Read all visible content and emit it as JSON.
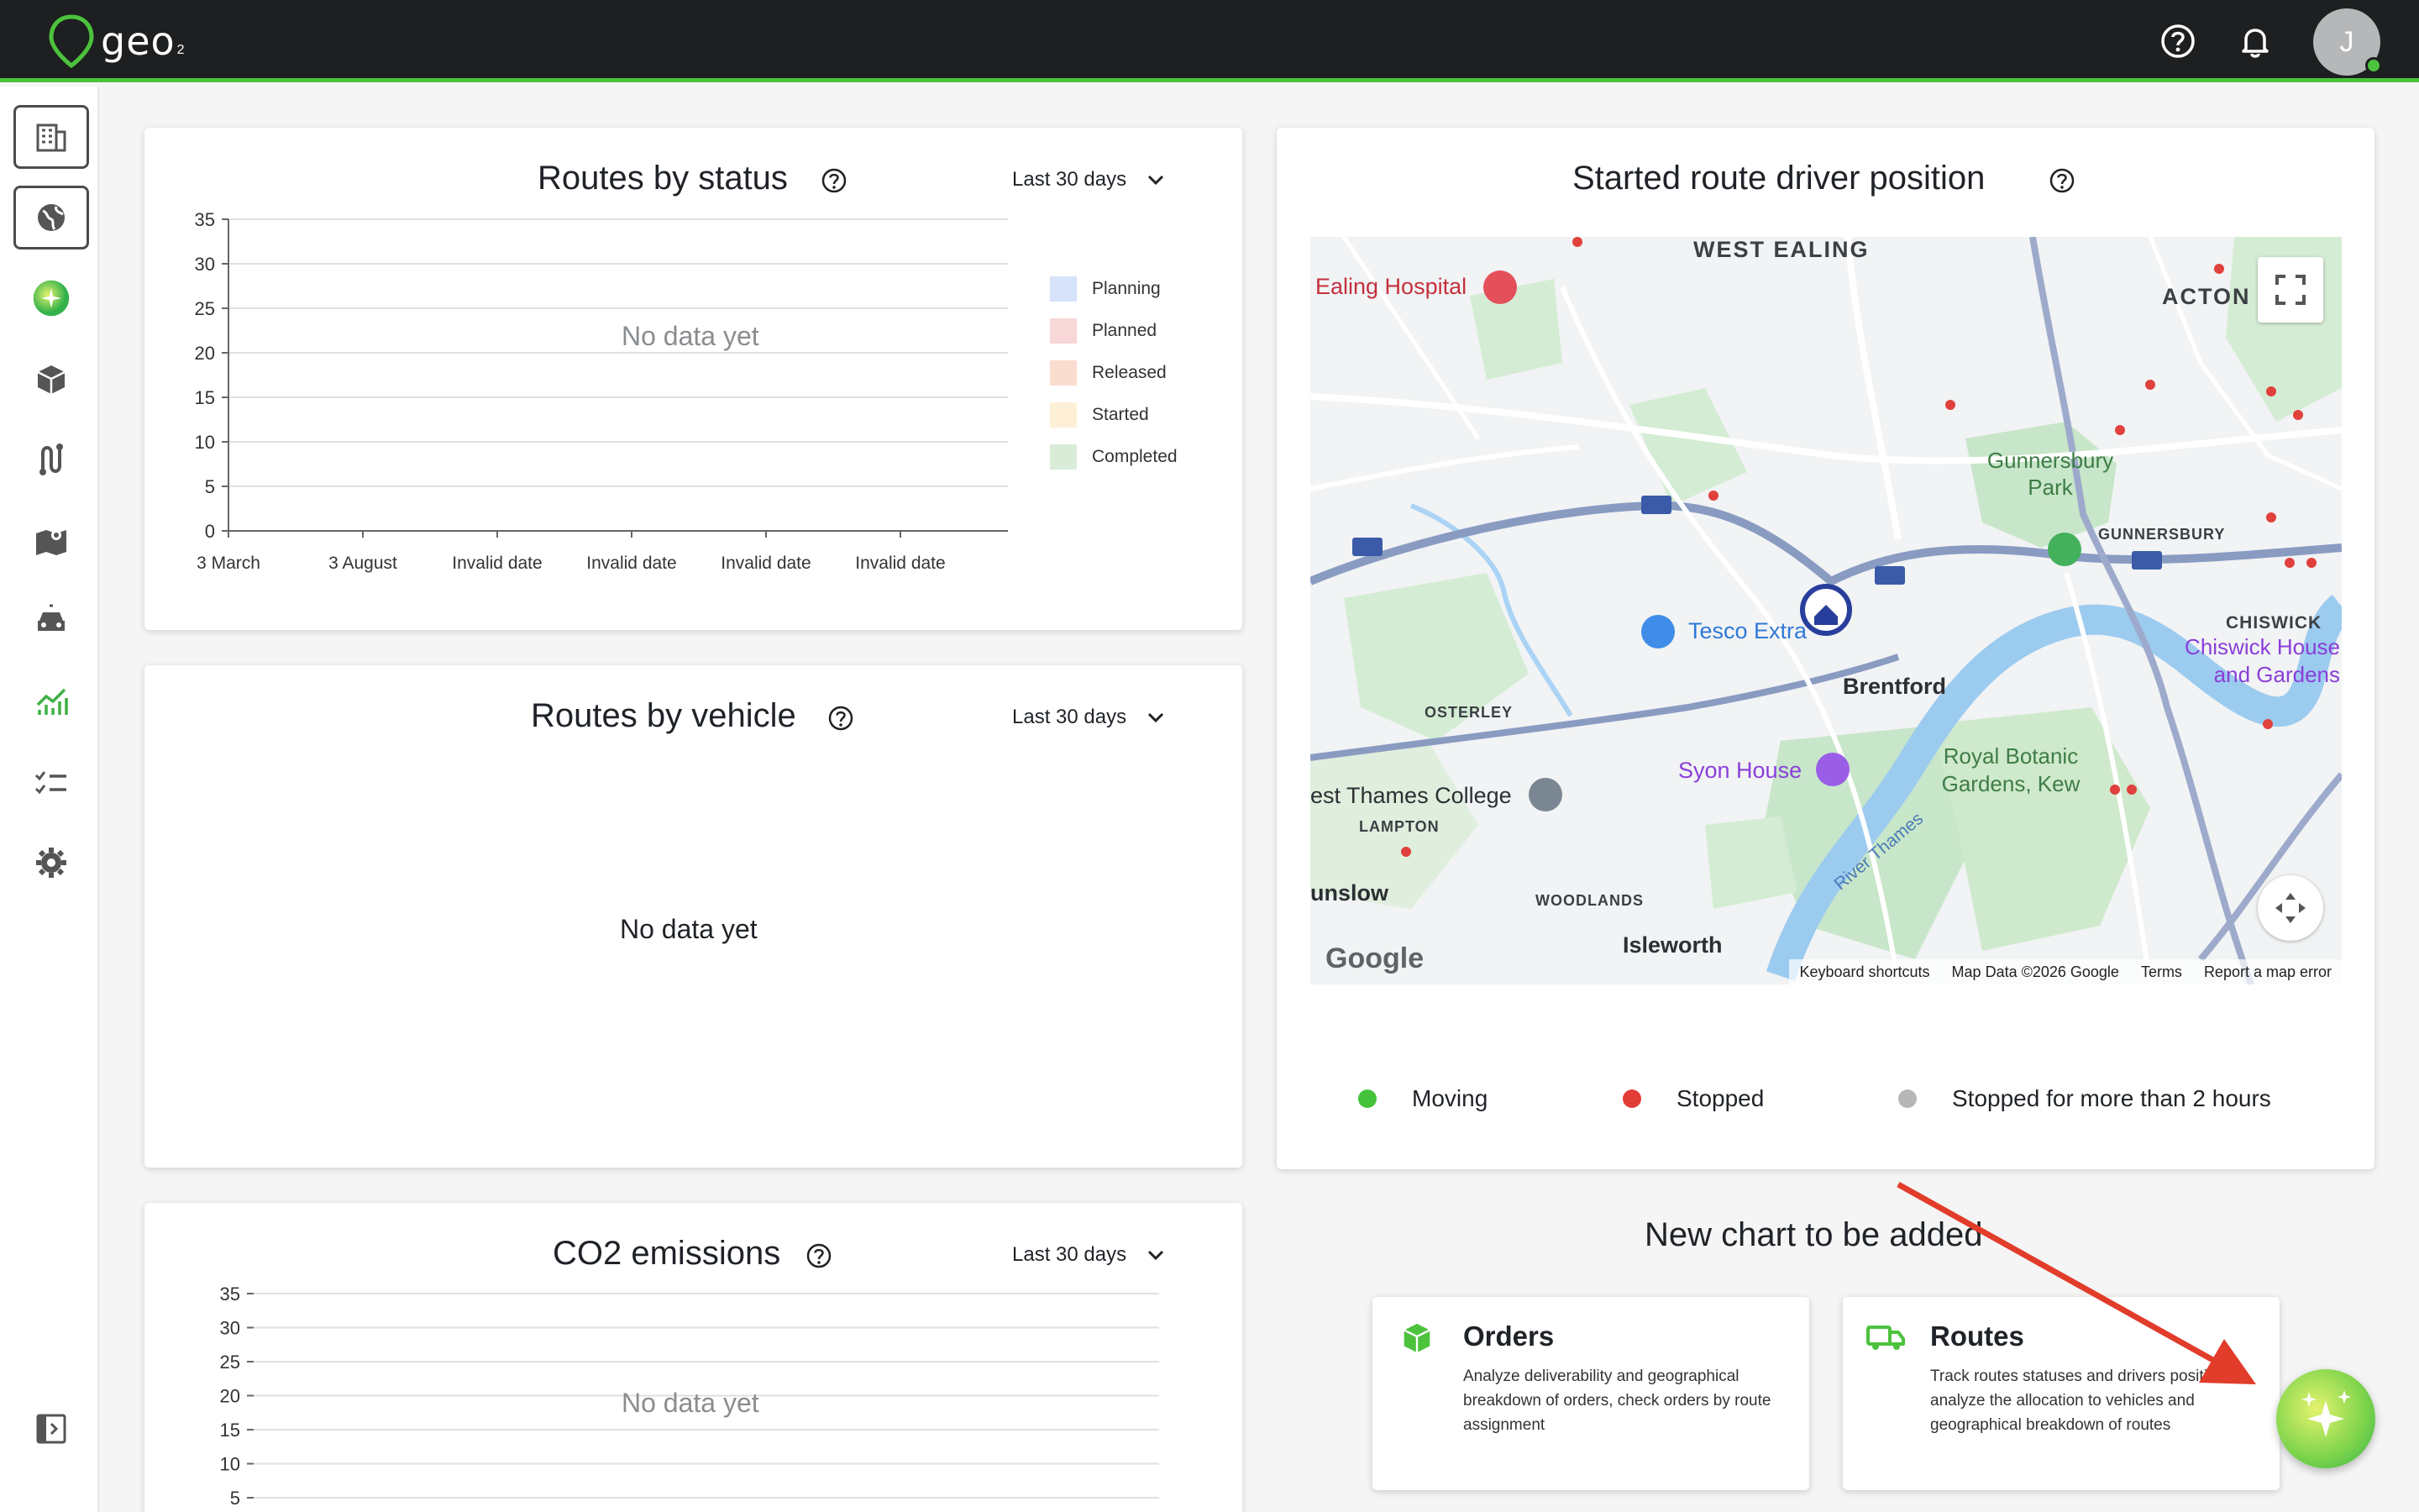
{
  "app": {
    "logo_text": "geo",
    "logo_sub": "2",
    "avatar_initial": "J",
    "brand_color": "#4cc23d"
  },
  "header": {
    "icons": [
      "help-circle-icon",
      "bell-icon"
    ]
  },
  "sidebar": {
    "items": [
      {
        "name": "sidebar-item-buildings",
        "icon": "building-icon"
      },
      {
        "name": "sidebar-item-globe",
        "icon": "globe-icon"
      },
      {
        "name": "sidebar-item-ai",
        "icon": "sparkle-icon"
      },
      {
        "name": "sidebar-item-orders",
        "icon": "package-icon"
      },
      {
        "name": "sidebar-item-routes",
        "icon": "route-icon"
      },
      {
        "name": "sidebar-item-map",
        "icon": "map-icon"
      },
      {
        "name": "sidebar-item-vehicles",
        "icon": "car-icon"
      },
      {
        "name": "sidebar-item-analytics",
        "icon": "chart-icon"
      },
      {
        "name": "sidebar-item-tasks",
        "icon": "checklist-icon"
      },
      {
        "name": "sidebar-item-settings",
        "icon": "gear-icon"
      }
    ]
  },
  "routes_by_status": {
    "title": "Routes by status",
    "range": "Last 30 days",
    "no_data": "No data yet",
    "legend": [
      {
        "label": "Planning",
        "color": "#d6e3fb"
      },
      {
        "label": "Planned",
        "color": "#f7d7d7"
      },
      {
        "label": "Released",
        "color": "#fbddd0"
      },
      {
        "label": "Started",
        "color": "#fdf0d6"
      },
      {
        "label": "Completed",
        "color": "#d9ecd8"
      }
    ]
  },
  "routes_by_vehicle": {
    "title": "Routes by vehicle",
    "range": "Last 30 days",
    "no_data": "No data yet"
  },
  "co2": {
    "title": "CO2 emissions",
    "range": "Last 30 days",
    "no_data": "No data yet"
  },
  "driver_position": {
    "title": "Started route driver position",
    "map_labels": {
      "west_ealing": "WEST EALING",
      "acton": "ACTON",
      "ealing_hospital": "Ealing Hospital",
      "gunnersbury_park": "Gunnersbury Park",
      "gunnersbury": "GUNNERSBURY",
      "chiswick": "CHISWICK",
      "chiswick_house": "Chiswick House and Gardens",
      "tesco": "Tesco Extra",
      "brentford": "Brentford",
      "osterley": "OSTERLEY",
      "syon_house": "Syon House",
      "royal_botanic": "Royal Botanic Gardens, Kew",
      "west_thames": "est Thames College",
      "lampton": "LAMPTON",
      "hounslow": "unslow",
      "woodlands": "WOODLANDS",
      "isleworth": "Isleworth",
      "river_thames": "River Thames",
      "google": "Google"
    },
    "map_footer": [
      "Keyboard shortcuts",
      "Map Data ©2026 Google",
      "Terms",
      "Report a map error"
    ],
    "legend": [
      {
        "label": "Moving",
        "color": "#45c23b"
      },
      {
        "label": "Stopped",
        "color": "#e23d36"
      },
      {
        "label": "Stopped for more than 2 hours",
        "color": "#b7b7b7"
      }
    ]
  },
  "new_chart": {
    "title": "New chart to be added",
    "cards": [
      {
        "title": "Orders",
        "icon": "package-icon",
        "desc": "Analyze deliverability and geographical breakdown of orders, check orders by route assignment"
      },
      {
        "title": "Routes",
        "icon": "truck-icon",
        "desc": "Track routes statuses and drivers positions, analyze the allocation to vehicles and geographical breakdown of routes"
      }
    ]
  },
  "chart_data": [
    {
      "type": "bar",
      "title": "Routes by status",
      "categories": [
        "3 March",
        "3 August",
        "Invalid date",
        "Invalid date",
        "Invalid date",
        "Invalid date"
      ],
      "yticks": [
        0,
        5,
        10,
        15,
        20,
        25,
        30,
        35
      ],
      "ylim": [
        0,
        35
      ],
      "series": [
        {
          "name": "Planning",
          "values": []
        },
        {
          "name": "Planned",
          "values": []
        },
        {
          "name": "Released",
          "values": []
        },
        {
          "name": "Started",
          "values": []
        },
        {
          "name": "Completed",
          "values": []
        }
      ],
      "grid": true,
      "legend": "right"
    },
    {
      "type": "line",
      "title": "CO2 emissions",
      "yticks": [
        5,
        10,
        15,
        20,
        25,
        30,
        35
      ],
      "ylim": [
        0,
        35
      ],
      "series": [],
      "grid": true
    }
  ]
}
